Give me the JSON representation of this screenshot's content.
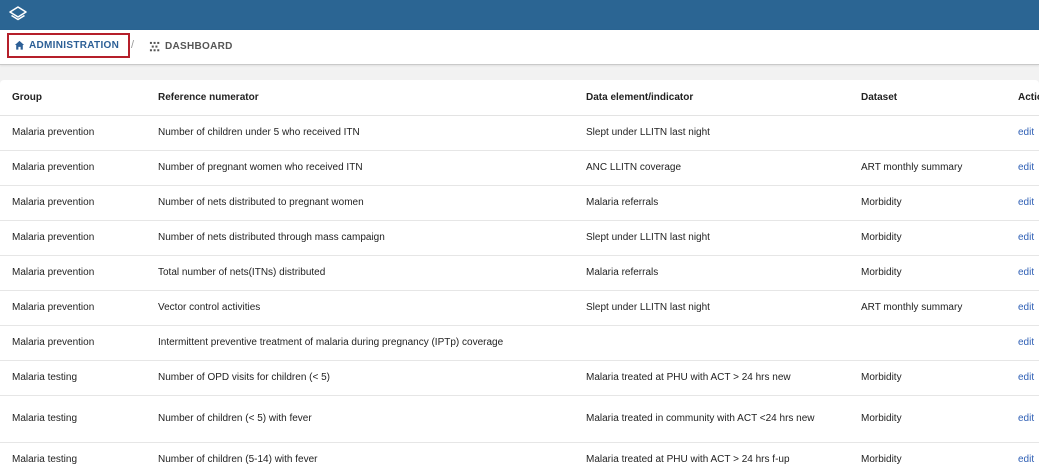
{
  "breadcrumb": {
    "admin_label": "ADMINISTRATION",
    "separator": "/",
    "dashboard_label": "DASHBOARD"
  },
  "table": {
    "headers": [
      "Group",
      "Reference numerator",
      "Data element/indicator",
      "Dataset",
      "Action"
    ],
    "rows": [
      [
        "Malaria prevention",
        "Number of children under 5 who received ITN",
        "Slept under LLITN last night",
        "",
        "edit"
      ],
      [
        "Malaria prevention",
        "Number of pregnant women who received ITN",
        "ANC LLITN coverage",
        "ART monthly summary",
        "edit"
      ],
      [
        "Malaria prevention",
        "Number of nets distributed to pregnant women",
        "Malaria referrals",
        "Morbidity",
        "edit"
      ],
      [
        "Malaria prevention",
        "Number of nets distributed through mass campaign",
        "Slept under LLITN last night",
        "Morbidity",
        "edit"
      ],
      [
        "Malaria prevention",
        "Total number of nets(ITNs) distributed",
        "Malaria referrals",
        "Morbidity",
        "edit"
      ],
      [
        "Malaria prevention",
        "Vector control activities",
        "Slept under LLITN last night",
        "ART monthly summary",
        "edit"
      ],
      [
        "Malaria prevention",
        "Intermittent preventive treatment of malaria during pregnancy (IPTp) coverage",
        "",
        "",
        "edit"
      ],
      [
        "Malaria testing",
        "Number of OPD visits for children (< 5)",
        "Malaria treated at PHU with ACT > 24 hrs new",
        "Morbidity",
        "edit"
      ],
      [
        "Malaria testing",
        "Number of children (< 5) with fever",
        "Malaria treated in community with ACT <24 hrs new",
        "Morbidity",
        "edit"
      ],
      [
        "Malaria testing",
        "Number of children (5-14) with fever",
        "Malaria treated at PHU with ACT > 24 hrs f-up",
        "Morbidity",
        "edit"
      ]
    ]
  },
  "colors": {
    "topbar": "#2b6593",
    "accent_link": "#3060b5",
    "highlight_border": "#b51f2a"
  },
  "icons": {
    "logo": "layers-icon",
    "admin": "home-icon",
    "dashboard": "dashboard-icon"
  }
}
